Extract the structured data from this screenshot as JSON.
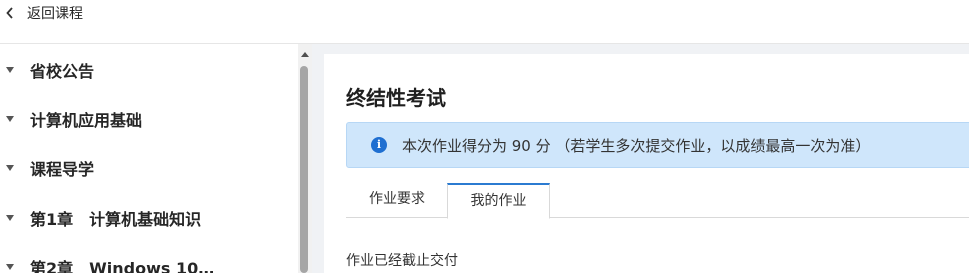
{
  "header": {
    "back_label": "返回课程"
  },
  "sidebar": {
    "items": [
      {
        "label": "省校公告"
      },
      {
        "label": "计算机应用基础"
      },
      {
        "label": "课程导学"
      },
      {
        "label": "第1章　计算机基础知识"
      },
      {
        "label": "第2章　Windows 10…"
      }
    ]
  },
  "main": {
    "title": "终结性考试",
    "alert": {
      "icon": "info-icon",
      "text": "本次作业得分为 90 分 （若学生多次提交作业，以成绩最高一次为准）"
    },
    "tabs": [
      {
        "label": "作业要求",
        "active": false
      },
      {
        "label": "我的作业",
        "active": true
      }
    ],
    "status_text": "作业已经截止交付"
  },
  "colors": {
    "accent": "#2b7bd1",
    "alert_bg": "#cfe6fb",
    "content_bg": "#f0f2f5"
  }
}
